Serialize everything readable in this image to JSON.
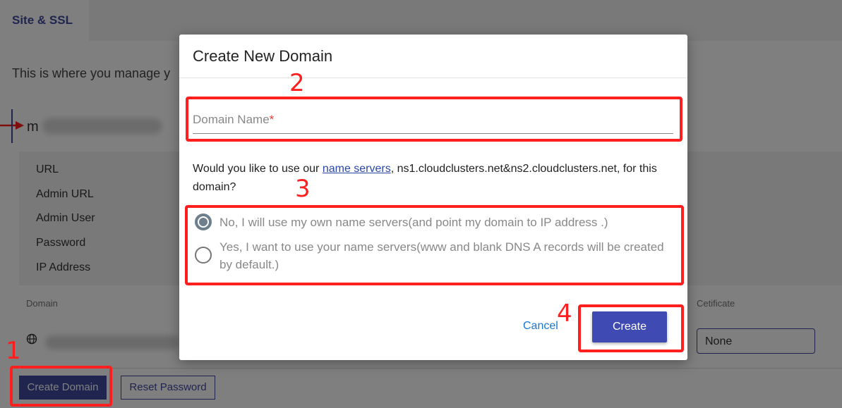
{
  "page": {
    "tab_label": "Site & SSL",
    "intro_text": "This is where you manage y",
    "site_name_initial": "m",
    "info_labels": [
      "URL",
      "Admin URL",
      "Admin User",
      "Password",
      "IP Address"
    ],
    "columns": {
      "domain": "Domain",
      "certificate": "Cetificate"
    },
    "certificate_value": "None",
    "create_domain_label": "Create Domain",
    "reset_password_label": "Reset Password"
  },
  "modal": {
    "title": "Create New Domain",
    "domain_placeholder": "Domain Name",
    "required_mark": "*",
    "question_prefix": "Would you like to use our ",
    "question_link": "name servers",
    "question_suffix": ", ns1.cloudclusters.net&ns2.cloudclusters.net, for this domain?",
    "options": [
      {
        "label": "No, I will use my own name servers(and point my domain to IP address .)",
        "selected": true
      },
      {
        "label": "Yes, I want to use your name servers(www and blank DNS A records will be created by default.)",
        "selected": false
      }
    ],
    "cancel_label": "Cancel",
    "create_label": "Create"
  },
  "annotations": {
    "steps": [
      "1",
      "2",
      "3",
      "4"
    ],
    "color": "#ff1f1f"
  },
  "colors": {
    "primary": "#3f4a9e",
    "link": "#1976d2"
  }
}
